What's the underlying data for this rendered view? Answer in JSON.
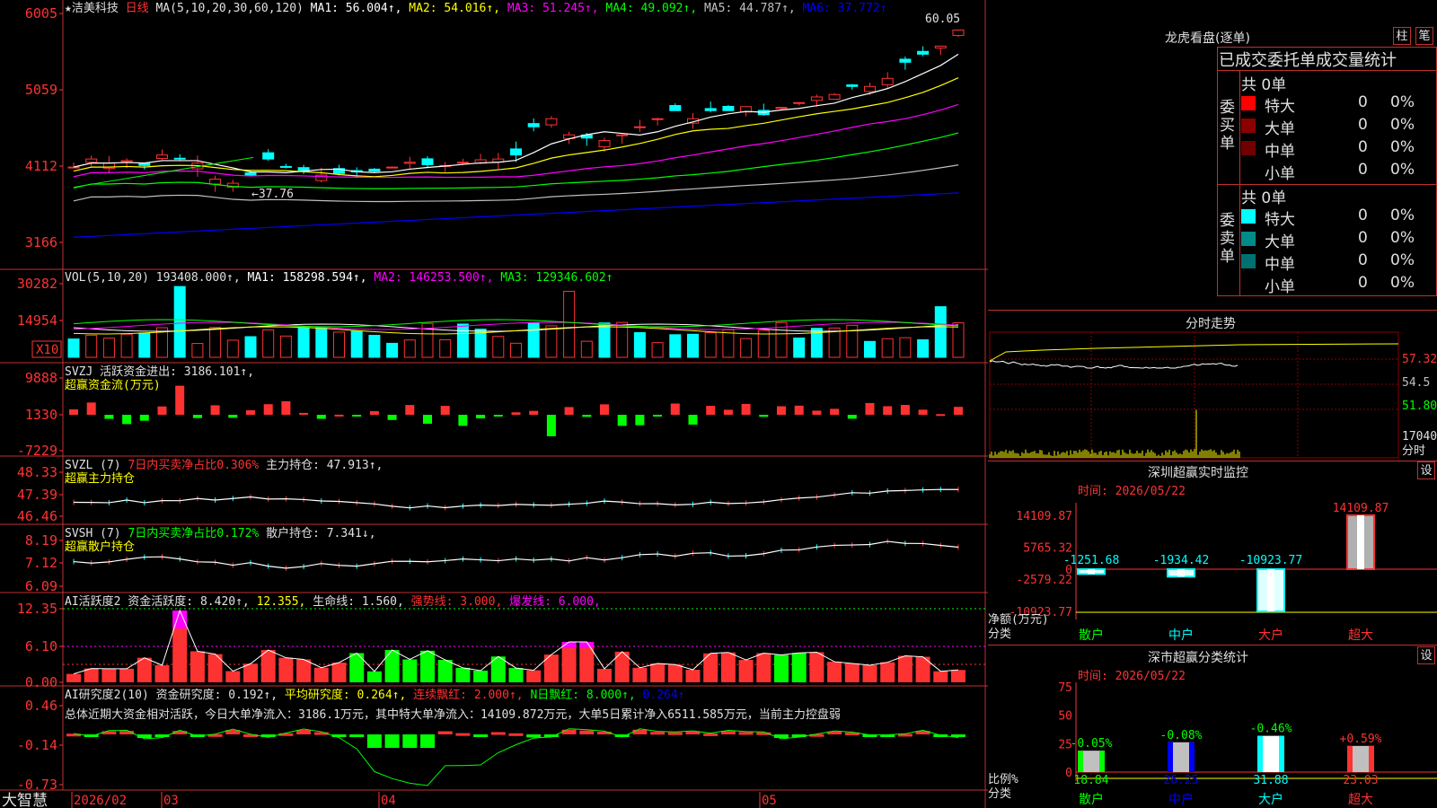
{
  "stock": {
    "star": "★",
    "name": "洁美科技",
    "period": "日线"
  },
  "colors": {
    "up": "#ff3232",
    "down": "#00ffff",
    "bg": "#000000",
    "grid": "#8b0000",
    "ma1": "#ffffff",
    "ma2": "#ffff00",
    "ma3": "#ff00ff",
    "ma4": "#00ff00",
    "ma5": "#c0c0c0",
    "ma6": "#0000ff"
  },
  "price_panel": {
    "header": {
      "ma_label": "MA(5,10,20,30,60,120)",
      "mas": [
        {
          "text": "MA1: 56.004↑,",
          "color": "#ffffff"
        },
        {
          "text": "MA2: 54.016↑,",
          "color": "#ffff00"
        },
        {
          "text": "MA3: 51.245↑,",
          "color": "#ff00ff"
        },
        {
          "text": "MA4: 49.092↑,",
          "color": "#00ff00"
        },
        {
          "text": "MA5: 44.787↑,",
          "color": "#c0c0c0"
        },
        {
          "text": "MA6: 37.772↑",
          "color": "#0000ff"
        }
      ]
    },
    "y_ticks": [
      "6005",
      "5059",
      "4112",
      "3166"
    ],
    "high_label": "60.05",
    "low_label": "←37.76"
  },
  "volume_panel": {
    "header": {
      "label": "VOL(5,10,20)",
      "value": "193408.000↑,",
      "mas": [
        {
          "text": "MA1: 158298.594↑,",
          "color": "#ffffff"
        },
        {
          "text": "MA2: 146253.500↑,",
          "color": "#ff00ff"
        },
        {
          "text": "MA3: 129346.602↑",
          "color": "#00ff00"
        }
      ]
    },
    "y_ticks": [
      "30282",
      "14954"
    ],
    "unit": "X10"
  },
  "svzj_panel": {
    "header1": "SVZJ  活跃资金进出: 3186.101↑,",
    "header2": "超赢资金流(万元)",
    "y_ticks": [
      "9888",
      "1330",
      "-7229"
    ]
  },
  "svzl_panel": {
    "header_a": "SVZL (7)",
    "header_b": "7日内买卖净占比0.306%",
    "header_c": "主力持仓: 47.913↑,",
    "header2": "超赢主力持仓",
    "y_ticks": [
      "48.33",
      "47.39",
      "46.46"
    ]
  },
  "svsh_panel": {
    "header_a": "SVSH (7)",
    "header_b": "7日内买卖净占比0.172%",
    "header_c": "散户持仓: 7.341↓,",
    "header2": "超赢散户持仓",
    "y_ticks": [
      "8.19",
      "7.12",
      "6.09"
    ]
  },
  "ai_active_panel": {
    "header": [
      {
        "text": "AI活跃度2 资金活跃度: 8.420↑,",
        "color": "#e0e0e0"
      },
      {
        "text": "12.355,",
        "color": "#ffff00"
      },
      {
        "text": "生命线: 1.560,",
        "color": "#e0e0e0"
      },
      {
        "text": "强势线: 3.000,",
        "color": "#ff3232"
      },
      {
        "text": "爆发线: 6.000,",
        "color": "#ff00ff"
      }
    ],
    "y_ticks": [
      "12.35",
      "6.10",
      "0.00"
    ]
  },
  "ai_research_panel": {
    "header": [
      {
        "text": "AI研究度2(10) 资金研究度: 0.192↑,",
        "color": "#e0e0e0"
      },
      {
        "text": "平均研究度: 0.264↑,",
        "color": "#ffff00"
      },
      {
        "text": "连续飘红: 2.000↑,",
        "color": "#ff3232"
      },
      {
        "text": "N日飘红: 8.000↑,",
        "color": "#00ff00"
      },
      {
        "text": "0.264↑",
        "color": "#0000ff"
      }
    ],
    "summary": "总体近期大资金相对活跃，今日大单净流入：3186.1万元，其中特大单净流入：14109.872万元，大单5日累计净入6511.585万元，当前主力控盘弱",
    "y_ticks": [
      "0.46",
      "-0.14",
      "-0.73"
    ]
  },
  "x_axis": {
    "brand": "大智慧",
    "labels": [
      "2026/02",
      "03",
      "04",
      "05"
    ]
  },
  "dragon": {
    "title": "龙虎看盘(逐单)",
    "btn1": "柱",
    "btn2": "笔",
    "subtitle": "已成交委托单成交量统计",
    "buy": {
      "side_label": "委\n买\n单",
      "total": "共 0单",
      "rows": [
        {
          "label": "特大",
          "count": "0",
          "pct": "0%",
          "color": "#ff0000"
        },
        {
          "label": "大单",
          "count": "0",
          "pct": "0%",
          "color": "#8b0000"
        },
        {
          "label": "中单",
          "count": "0",
          "pct": "0%",
          "color": "#700000"
        },
        {
          "label": "小单",
          "count": "0",
          "pct": "0%",
          "color": "#000000"
        }
      ]
    },
    "sell": {
      "side_label": "委\n卖\n单",
      "total": "共 0单",
      "rows": [
        {
          "label": "特大",
          "count": "0",
          "pct": "0%",
          "color": "#00ffff"
        },
        {
          "label": "大单",
          "count": "0",
          "pct": "0%",
          "color": "#008b8b"
        },
        {
          "label": "中单",
          "count": "0",
          "pct": "0%",
          "color": "#007070"
        },
        {
          "label": "小单",
          "count": "0",
          "pct": "0%",
          "color": "#000000"
        }
      ]
    }
  },
  "intraday": {
    "title": "分时走势",
    "y_ticks": [
      "57.32",
      "54.5",
      "51.80"
    ],
    "vol_label": "17040",
    "vol_unit": "分时"
  },
  "monitor": {
    "title": "深圳超赢实时监控",
    "settings": "设",
    "time": "时间: 2026/05/22",
    "y_ticks": [
      "14109.87",
      "5765.32",
      "0",
      "-2579.22",
      "-10923.77"
    ],
    "unit_label": "净额(万元)",
    "cat_label": "分类"
  },
  "classify": {
    "title": "深市超赢分类统计",
    "settings": "设",
    "time": "时间: 2026/05/22",
    "y_ticks": [
      "75",
      "50",
      "25",
      "0"
    ],
    "unit_label": "比例%",
    "cat_label": "分类"
  },
  "chart_data": [
    {
      "type": "candlestick",
      "title": "洁美科技 日线",
      "x_labels": [
        "2026/02",
        "03",
        "04",
        "05"
      ],
      "y_ticks": [
        31.66,
        41.12,
        50.59,
        60.05
      ],
      "high": 60.05,
      "low": 37.76,
      "series": [
        {
          "name": "MA1",
          "last": 56.004
        },
        {
          "name": "MA2",
          "last": 54.016
        },
        {
          "name": "MA3",
          "last": 51.245
        },
        {
          "name": "MA4",
          "last": 49.092
        },
        {
          "name": "MA5",
          "last": 44.787
        },
        {
          "name": "MA6",
          "last": 37.772
        }
      ]
    },
    {
      "type": "bar",
      "title": "VOL(5,10,20)",
      "last": 193408.0,
      "ylim": [
        0,
        30282
      ],
      "series": [
        {
          "name": "MA1",
          "last": 158298.594
        },
        {
          "name": "MA2",
          "last": 146253.5
        },
        {
          "name": "MA3",
          "last": 129346.602
        }
      ]
    },
    {
      "type": "bar",
      "title": "深圳超赢实时监控",
      "categories": [
        "散户",
        "中户",
        "大户",
        "超大"
      ],
      "values": [
        -1251.68,
        -1934.42,
        -10923.77,
        14109.87
      ],
      "ylim": [
        -10923.77,
        14109.87
      ]
    },
    {
      "type": "bar",
      "title": "深市超赢分类统计",
      "categories": [
        "散户",
        "中户",
        "大户",
        "超大"
      ],
      "values": [
        18.84,
        26.25,
        31.88,
        23.03
      ],
      "changes": [
        "-0.05%",
        "-0.08%",
        "-0.46%",
        "+0.59%"
      ],
      "ylim": [
        0,
        75
      ]
    }
  ]
}
